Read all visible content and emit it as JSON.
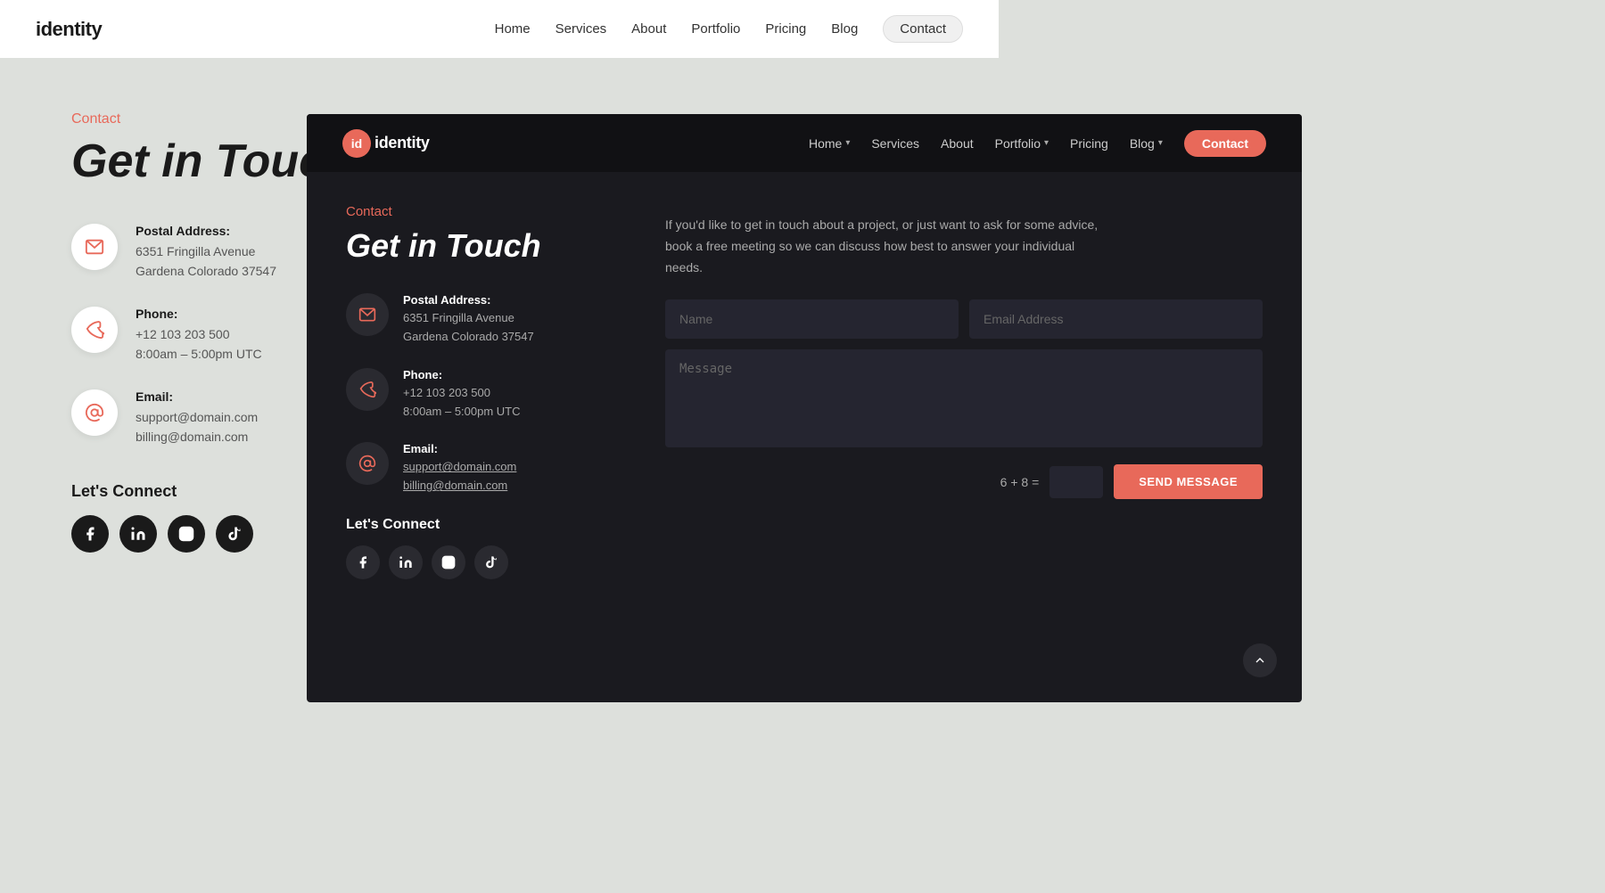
{
  "light": {
    "logo": "identity",
    "nav": {
      "home": "Home",
      "services": "Services",
      "about": "About",
      "portfolio": "Portfolio",
      "pricing": "Pricing",
      "blog": "Blog",
      "contact": "Contact"
    },
    "page": {
      "contact_label": "Contact",
      "heading": "Get in Touch",
      "postal_label": "Postal Address:",
      "postal_line1": "6351 Fringilla Avenue",
      "postal_line2": "Gardena Colorado 37547",
      "phone_label": "Phone:",
      "phone_number": "+12 103 203 500",
      "phone_hours": "8:00am – 5:00pm UTC",
      "email_label": "Email:",
      "email_support": "support@domain.com",
      "email_billing": "billing@domain.com",
      "connect_title": "Let's Connect"
    }
  },
  "dark": {
    "logo_text": "identity",
    "logo_icon": "id",
    "nav": {
      "home": "Home",
      "services": "Services",
      "about": "About",
      "portfolio": "Portfolio",
      "pricing": "Pricing",
      "blog": "Blog",
      "contact": "Contact"
    },
    "page": {
      "contact_label": "Contact",
      "heading": "Get in Touch",
      "description": "If you'd like to get in touch about a project, or just want to ask for some advice, book a free meeting so we can discuss how best to answer your individual needs.",
      "postal_label": "Postal Address:",
      "postal_line1": "6351 Fringilla Avenue",
      "postal_line2": "Gardena Colorado 37547",
      "phone_label": "Phone:",
      "phone_number": "+12 103 203 500",
      "phone_hours": "8:00am – 5:00pm UTC",
      "email_label": "Email:",
      "email_support": "support@domain.com",
      "email_billing": "billing@domain.com",
      "connect_title": "Let's Connect",
      "name_placeholder": "Name",
      "email_placeholder": "Email Address",
      "message_placeholder": "Message",
      "captcha": "6 + 8 =",
      "send_label": "SEND MESSAGE"
    }
  }
}
